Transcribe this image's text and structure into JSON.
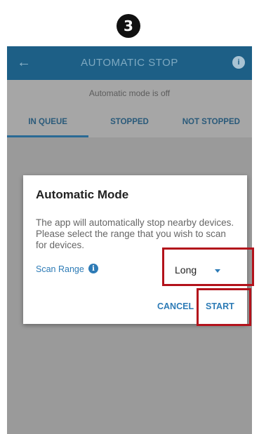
{
  "step_badge": "3",
  "app_bar": {
    "title": "AUTOMATIC STOP",
    "back_icon": "←",
    "info_icon": "i"
  },
  "status": "Automatic mode is off",
  "tabs": [
    {
      "label": "IN QUEUE",
      "active": true
    },
    {
      "label": "STOPPED",
      "active": false
    },
    {
      "label": "NOT STOPPED",
      "active": false
    }
  ],
  "dialog": {
    "title": "Automatic Mode",
    "body": "The app will automatically stop nearby devices. Please select the range that you wish to scan for devices.",
    "scan_range_label": "Scan Range",
    "scan_info_icon": "i",
    "range_value": "Long",
    "cancel_label": "CANCEL",
    "start_label": "START"
  },
  "colors": {
    "app_bar": "#1d5f86",
    "accent": "#2d7bb6",
    "highlight": "#b3121b",
    "overlay": "#9a9a9a"
  }
}
